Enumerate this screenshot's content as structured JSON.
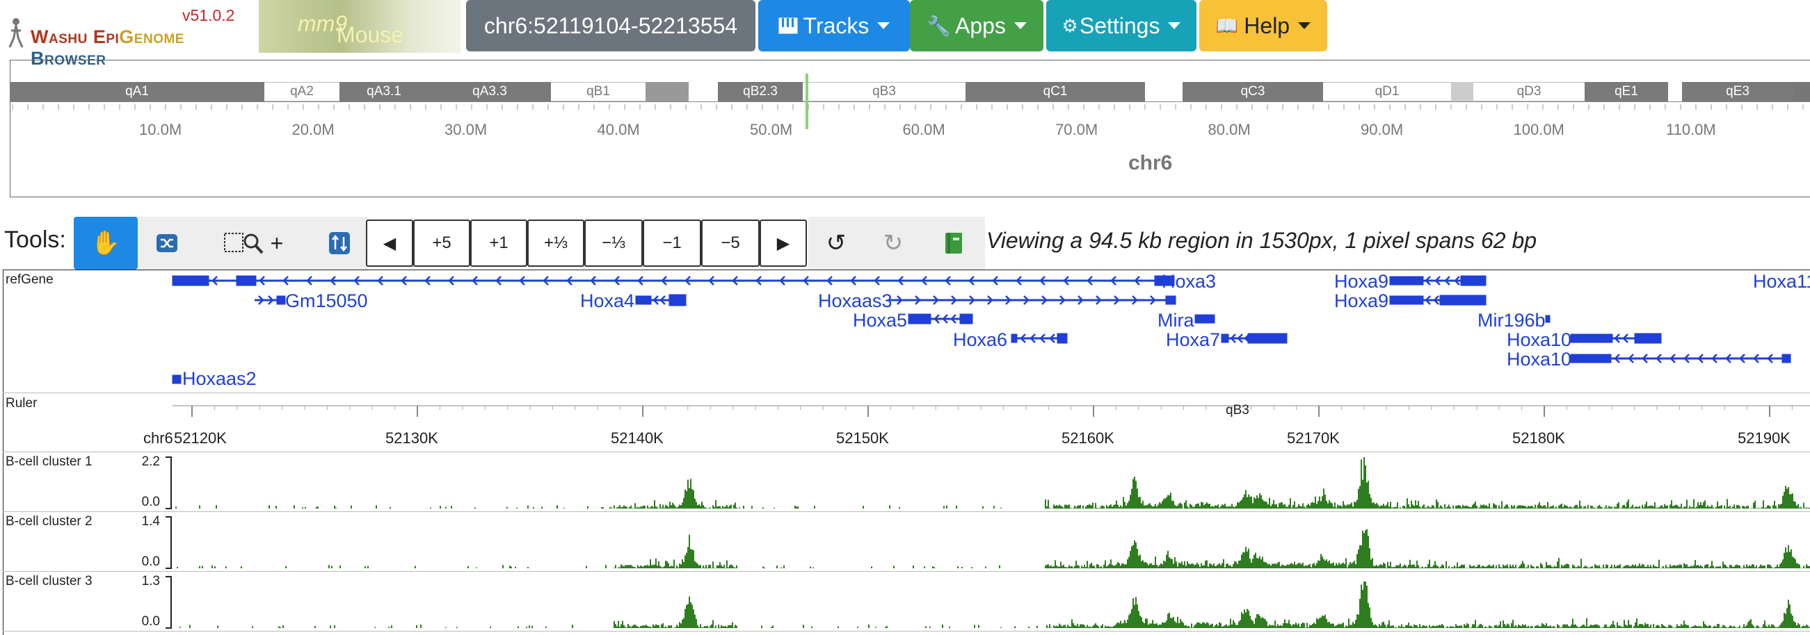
{
  "app": {
    "version": "v51.0.2",
    "brand_a": "Washu Epi",
    "brand_b": "Genome",
    "brand_c": " Browser",
    "genome_prefix": "Mouse ",
    "genome_name": "mm9"
  },
  "nav": {
    "region": "chr6:52119104-52213554",
    "tracks": "Tracks",
    "apps": "Apps",
    "settings": "Settings",
    "help": "Help"
  },
  "colors": {
    "region_btn": "#6c757d",
    "tracks_btn": "#1e88e5",
    "apps_btn": "#43a047",
    "settings_btn": "#17a2b8",
    "help_btn": "#f7c237",
    "gene": "#1f3fd8",
    "signal": "#2e7d1f"
  },
  "ideogram": {
    "chrom": "chr6",
    "bands": [
      {
        "name": "qA1",
        "tone": "dark"
      },
      {
        "name": "qA2",
        "tone": "light"
      },
      {
        "name": "qA3.1",
        "tone": "dark"
      },
      {
        "name": "qA3.3",
        "tone": "dark"
      },
      {
        "name": "qB1",
        "tone": "light"
      },
      {
        "name": "qB2.3",
        "tone": "dark"
      },
      {
        "name": "qB3",
        "tone": "light"
      },
      {
        "name": "qC1",
        "tone": "dark"
      },
      {
        "name": "qC3",
        "tone": "dark"
      },
      {
        "name": "qD1",
        "tone": "light"
      },
      {
        "name": "qD3",
        "tone": "light"
      },
      {
        "name": "qE1",
        "tone": "dark"
      },
      {
        "name": "qE3",
        "tone": "dark"
      }
    ],
    "ticks": [
      "10.0M",
      "20.0M",
      "30.0M",
      "40.0M",
      "50.0M",
      "60.0M",
      "70.0M",
      "80.0M",
      "90.0M",
      "100.0M",
      "110.0M"
    ]
  },
  "tools": {
    "label": "Tools:",
    "drag_icon": "hand-icon",
    "reorder_icon": "shuffle-icon",
    "zoom_icon": "zoom-box-icon",
    "zoom_plus": "+",
    "sync_icon": "sync-icon",
    "nav": [
      "◀",
      "+5",
      "+1",
      "+⅓",
      "−⅓",
      "−1",
      "−5",
      "▶"
    ],
    "undo_icon": "undo-icon",
    "redo_icon": "redo-icon",
    "book_icon": "book-icon",
    "viewing": "Viewing a 94.5 kb region in 1530px, 1 pixel spans 62 bp"
  },
  "tracks": {
    "refgene_label": "refGene",
    "genes": [
      "Hoxa3",
      "Gm15050",
      "Hoxa4",
      "Hoxaas3",
      "Hoxa5",
      "Hoxa6",
      "Mira",
      "Hoxa7",
      "Hoxa9",
      "Hoxa9",
      "Mir196b",
      "Hoxa10",
      "Hoxa10",
      "Hoxaas2",
      "Hoxa11"
    ],
    "ruler_label": "Ruler",
    "ruler_band": "qB3",
    "ruler_chrom": "chr6",
    "ruler_ticks": [
      "52120K",
      "52130K",
      "52140K",
      "52150K",
      "52160K",
      "52170K",
      "52180K",
      "52190K"
    ],
    "signals": [
      {
        "name": "B-cell cluster 1",
        "max": "2.2",
        "min": "0.0"
      },
      {
        "name": "B-cell cluster 2",
        "max": "1.4",
        "min": "0.0"
      },
      {
        "name": "B-cell cluster 3",
        "max": "1.3",
        "min": "0.0"
      }
    ]
  }
}
